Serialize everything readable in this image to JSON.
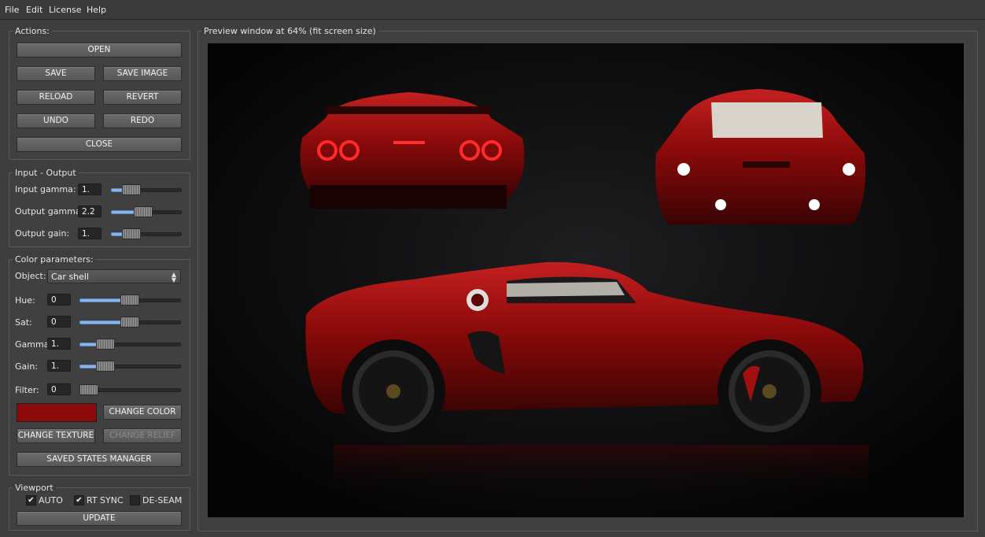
{
  "menu": [
    "File",
    "Edit",
    "License",
    "Help"
  ],
  "actions": {
    "title": "Actions:",
    "open": "OPEN",
    "save": "SAVE",
    "save_image": "SAVE IMAGE",
    "reload": "RELOAD",
    "revert": "REVERT",
    "undo": "UNDO",
    "redo": "REDO",
    "close": "CLOSE"
  },
  "io": {
    "title": "Input - Output",
    "input_gamma_label": "Input gamma:",
    "input_gamma_value": "1.",
    "output_gamma_label": "Output gamma:",
    "output_gamma_value": "2.2",
    "output_gain_label": "Output gain:",
    "output_gain_value": "1."
  },
  "color": {
    "title": "Color parameters:",
    "object_label": "Object:",
    "object_value": "Car shell",
    "hue_label": "Hue:",
    "hue_value": "0",
    "sat_label": "Sat:",
    "sat_value": "0",
    "gamma_label": "Gamma:",
    "gamma_value": "1.",
    "gain_label": "Gain:",
    "gain_value": "1.",
    "filter_label": "Filter:",
    "filter_value": "0",
    "swatch_color": "#8b0a0a",
    "change_color": "CHANGE COLOR",
    "change_texture": "CHANGE TEXTURE",
    "change_relief": "CHANGE RELIEF",
    "saved_states": "SAVED STATES MANAGER"
  },
  "viewport": {
    "title": "Viewport",
    "auto": "AUTO",
    "auto_checked": true,
    "rt_sync": "RT SYNC",
    "rt_sync_checked": true,
    "de_seam": "DE-SEAM",
    "de_seam_checked": false,
    "update": "UPDATE"
  },
  "preview": {
    "title": "Preview window at 64% (fit screen size)",
    "body_color": "#8b0a0a",
    "background_color": "#050506"
  }
}
